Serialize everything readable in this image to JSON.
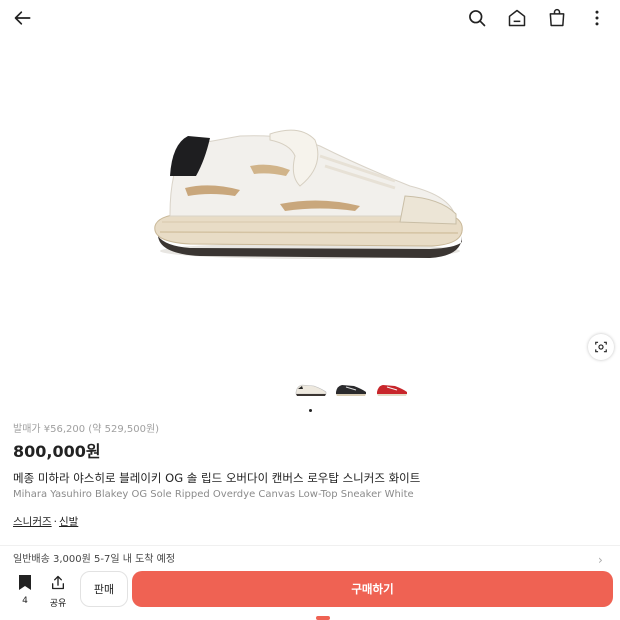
{
  "topbar": {
    "back_icon": "arrow-left-icon",
    "search_icon": "search-icon",
    "home_icon": "home-icon",
    "cart_icon": "shopping-bag-icon",
    "more_icon": "more-vertical-icon"
  },
  "product": {
    "launch_price": "발매가 ¥56,200 (약 529,500원)",
    "price": "800,000원",
    "name_ko": "메종 미하라 야스히로 블레이키 OG 솔 립드 오버다이 캔버스 로우탑 스니커즈 화이트",
    "name_en": "Mihara Yasuhiro Blakey OG Sole Ripped Overdye Canvas Low-Top Sneaker White",
    "categories": [
      "스니커즈",
      "신발"
    ],
    "category_separator": "·"
  },
  "gallery": {
    "thumbnails": [
      "white",
      "black",
      "red"
    ],
    "active_index": 0
  },
  "shipping": {
    "text": "일반배송 3,000원 5-7일 내 도착 예정"
  },
  "bottom_bar": {
    "bookmark_count": "4",
    "share_label": "공유",
    "sell_label": "판매",
    "buy_label": "구매하기"
  },
  "colors": {
    "accent": "#ef6253",
    "text": "#222222",
    "muted": "#a0a0a0"
  }
}
